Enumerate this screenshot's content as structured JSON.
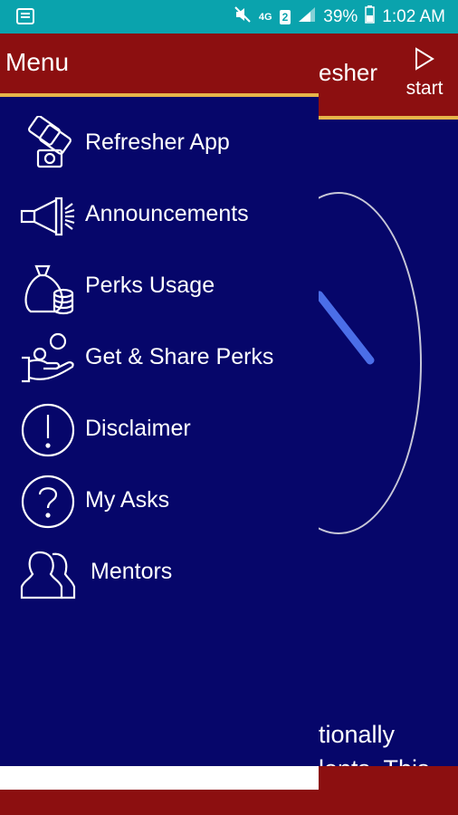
{
  "status_bar": {
    "network": "4G",
    "sim": "2",
    "battery": "39%",
    "time": "1:02 AM"
  },
  "background": {
    "title": "esher",
    "start_label": "start",
    "text_line1": "tionally",
    "text_line2": "lents. This"
  },
  "drawer": {
    "title": "Menu",
    "items": [
      {
        "label": "Refresher App",
        "icon": "refresher-app-icon"
      },
      {
        "label": "Announcements",
        "icon": "megaphone-icon"
      },
      {
        "label": "Perks Usage",
        "icon": "money-bag-icon"
      },
      {
        "label": "Get & Share Perks",
        "icon": "hand-coin-icon"
      },
      {
        "label": "Disclaimer",
        "icon": "exclamation-icon"
      },
      {
        "label": "My Asks",
        "icon": "question-icon"
      },
      {
        "label": "Mentors",
        "icon": "people-icon"
      }
    ]
  },
  "colors": {
    "status_bar": "#0aa3ad",
    "app_bar": "#8c0f10",
    "accent_line": "#e6b44a",
    "drawer_bg": "#06066a"
  }
}
